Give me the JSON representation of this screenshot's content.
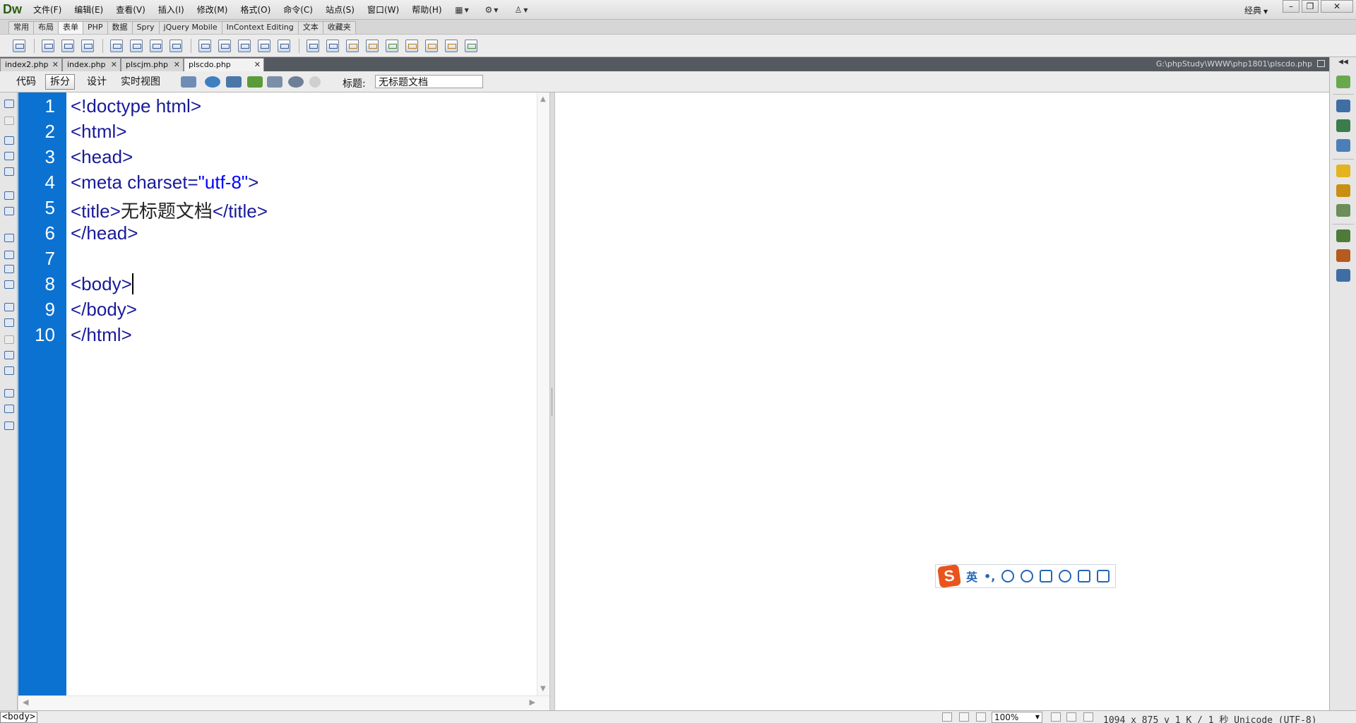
{
  "app": {
    "logo": "Dw"
  },
  "menubar": {
    "items": [
      "文件(F)",
      "编辑(E)",
      "查看(V)",
      "插入(I)",
      "修改(M)",
      "格式(O)",
      "命令(C)",
      "站点(S)",
      "窗口(W)",
      "帮助(H)"
    ],
    "workspace": "经典",
    "window_buttons": [
      "–",
      "❐",
      "✕"
    ]
  },
  "insert_panel": {
    "tabs": [
      "常用",
      "布局",
      "表单",
      "PHP",
      "数据",
      "Spry",
      "jQuery Mobile",
      "InContext Editing",
      "文本",
      "收藏夹"
    ],
    "active_tab": "表单"
  },
  "document_tabs": {
    "tabs": [
      {
        "name": "index2.php"
      },
      {
        "name": "index.php"
      },
      {
        "name": "plscjm.php"
      },
      {
        "name": "plscdo.php"
      }
    ],
    "active": "plscdo.php",
    "path": "G:\\phpStudy\\WWW\\php1801\\plscdo.php"
  },
  "doc_toolbar": {
    "views": [
      "代码",
      "拆分",
      "设计",
      "实时视图"
    ],
    "active_view": "拆分",
    "title_label": "标题:",
    "title_value": "无标题文档"
  },
  "code": {
    "line_numbers": [
      "1",
      "2",
      "3",
      "4",
      "5",
      "6",
      "7",
      "8",
      "9",
      "10"
    ],
    "lines": {
      "l1": "<!doctype html>",
      "l2": "<html>",
      "l3": "<head>",
      "l4a": "<meta charset=",
      "l4b": "\"utf-8\"",
      "l4c": ">",
      "l5a": "<title>",
      "l5b": "无标题文档",
      "l5c": "</title>",
      "l6": "</head>",
      "l7": "",
      "l8": "<body>",
      "l9": "</body>",
      "l10": "</html>"
    }
  },
  "ime_toolbar": {
    "logo": "S",
    "mode": "英",
    "punct": "•,"
  },
  "status_bar": {
    "tag": "<body>",
    "zoom": "100%",
    "info": "1094 x 875 v 1 K / 1 秒 Unicode (UTF-8)"
  },
  "colors": {
    "gutter": "#0b72d2",
    "tag_text": "#1a1a99",
    "string_text": "#0000ff",
    "ime_logo": "#e8541c"
  }
}
